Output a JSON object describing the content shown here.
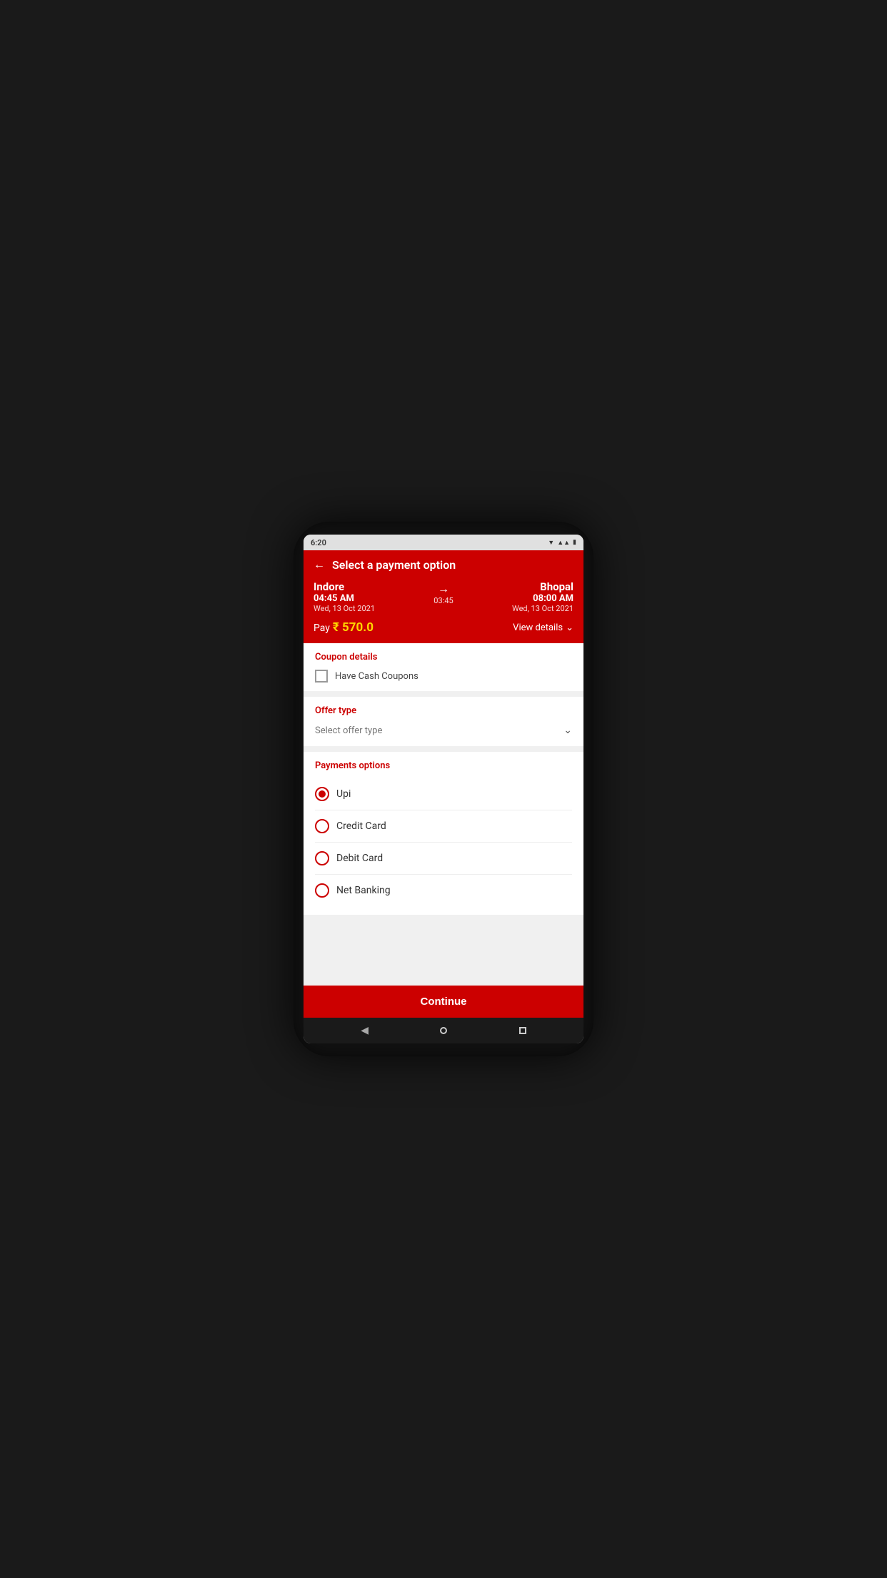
{
  "status_bar": {
    "time": "6:20",
    "icons": [
      "●",
      "▼",
      "4",
      "🔋"
    ]
  },
  "header": {
    "back_label": "←",
    "title": "Select a payment option",
    "origin": {
      "city": "Indore",
      "time": "04:45 AM",
      "date": "Wed, 13 Oct 2021"
    },
    "destination": {
      "city": "Bhopal",
      "time": "08:00 AM",
      "date": "Wed, 13 Oct 2021"
    },
    "duration": "03:45",
    "arrow": "→",
    "pay_label": "Pay",
    "pay_amount": "₹ 570.0",
    "view_details_label": "View details",
    "chevron": "⌄"
  },
  "coupon_section": {
    "title": "Coupon details",
    "checkbox_label": "Have Cash Coupons",
    "checked": false
  },
  "offer_section": {
    "title": "Offer type",
    "placeholder": "Select offer type",
    "chevron": "⌄"
  },
  "payment_section": {
    "title": "Payments options",
    "options": [
      {
        "id": "upi",
        "label": "Upi",
        "selected": true
      },
      {
        "id": "credit_card",
        "label": "Credit Card",
        "selected": false
      },
      {
        "id": "debit_card",
        "label": "Debit Card",
        "selected": false
      },
      {
        "id": "net_banking",
        "label": "Net Banking",
        "selected": false
      }
    ]
  },
  "footer": {
    "continue_label": "Continue"
  }
}
